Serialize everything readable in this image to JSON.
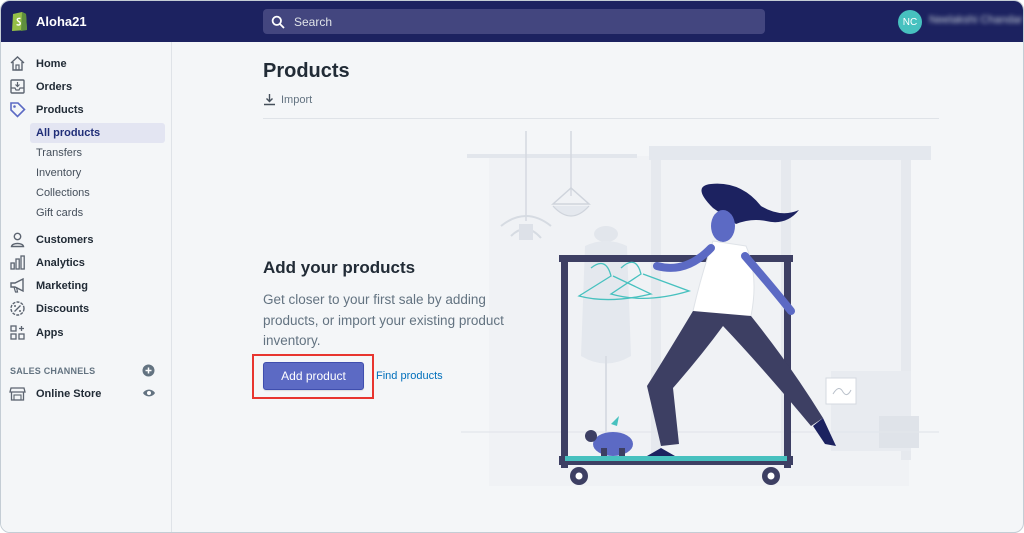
{
  "app": {
    "store_name": "Aloha21"
  },
  "topbar": {
    "search_placeholder": "Search",
    "user_initials": "NC",
    "user_name": "Neelakshi Chandar"
  },
  "sidebar": {
    "items": [
      {
        "label": "Home",
        "icon": "home-icon"
      },
      {
        "label": "Orders",
        "icon": "orders-icon"
      },
      {
        "label": "Products",
        "icon": "tag-icon"
      },
      {
        "label": "Customers",
        "icon": "person-icon"
      },
      {
        "label": "Analytics",
        "icon": "bar-chart-icon"
      },
      {
        "label": "Marketing",
        "icon": "megaphone-icon"
      },
      {
        "label": "Discounts",
        "icon": "discount-icon"
      },
      {
        "label": "Apps",
        "icon": "apps-icon"
      }
    ],
    "product_subitems": [
      {
        "label": "All products",
        "active": true
      },
      {
        "label": "Transfers"
      },
      {
        "label": "Inventory"
      },
      {
        "label": "Collections"
      },
      {
        "label": "Gift cards"
      }
    ],
    "sales_channels_title": "SALES CHANNELS",
    "online_store_label": "Online Store"
  },
  "main": {
    "title": "Products",
    "import_label": "Import",
    "empty_title": "Add your products",
    "empty_description": "Get closer to your first sale by adding products, or import your existing product inventory.",
    "add_product_label": "Add product",
    "find_products_label": "Find products"
  },
  "colors": {
    "topbar": "#1c2260",
    "primary_button": "#5c6ac4",
    "link": "#006fbb",
    "highlight_box": "#e8352f",
    "avatar": "#47c1bf"
  }
}
